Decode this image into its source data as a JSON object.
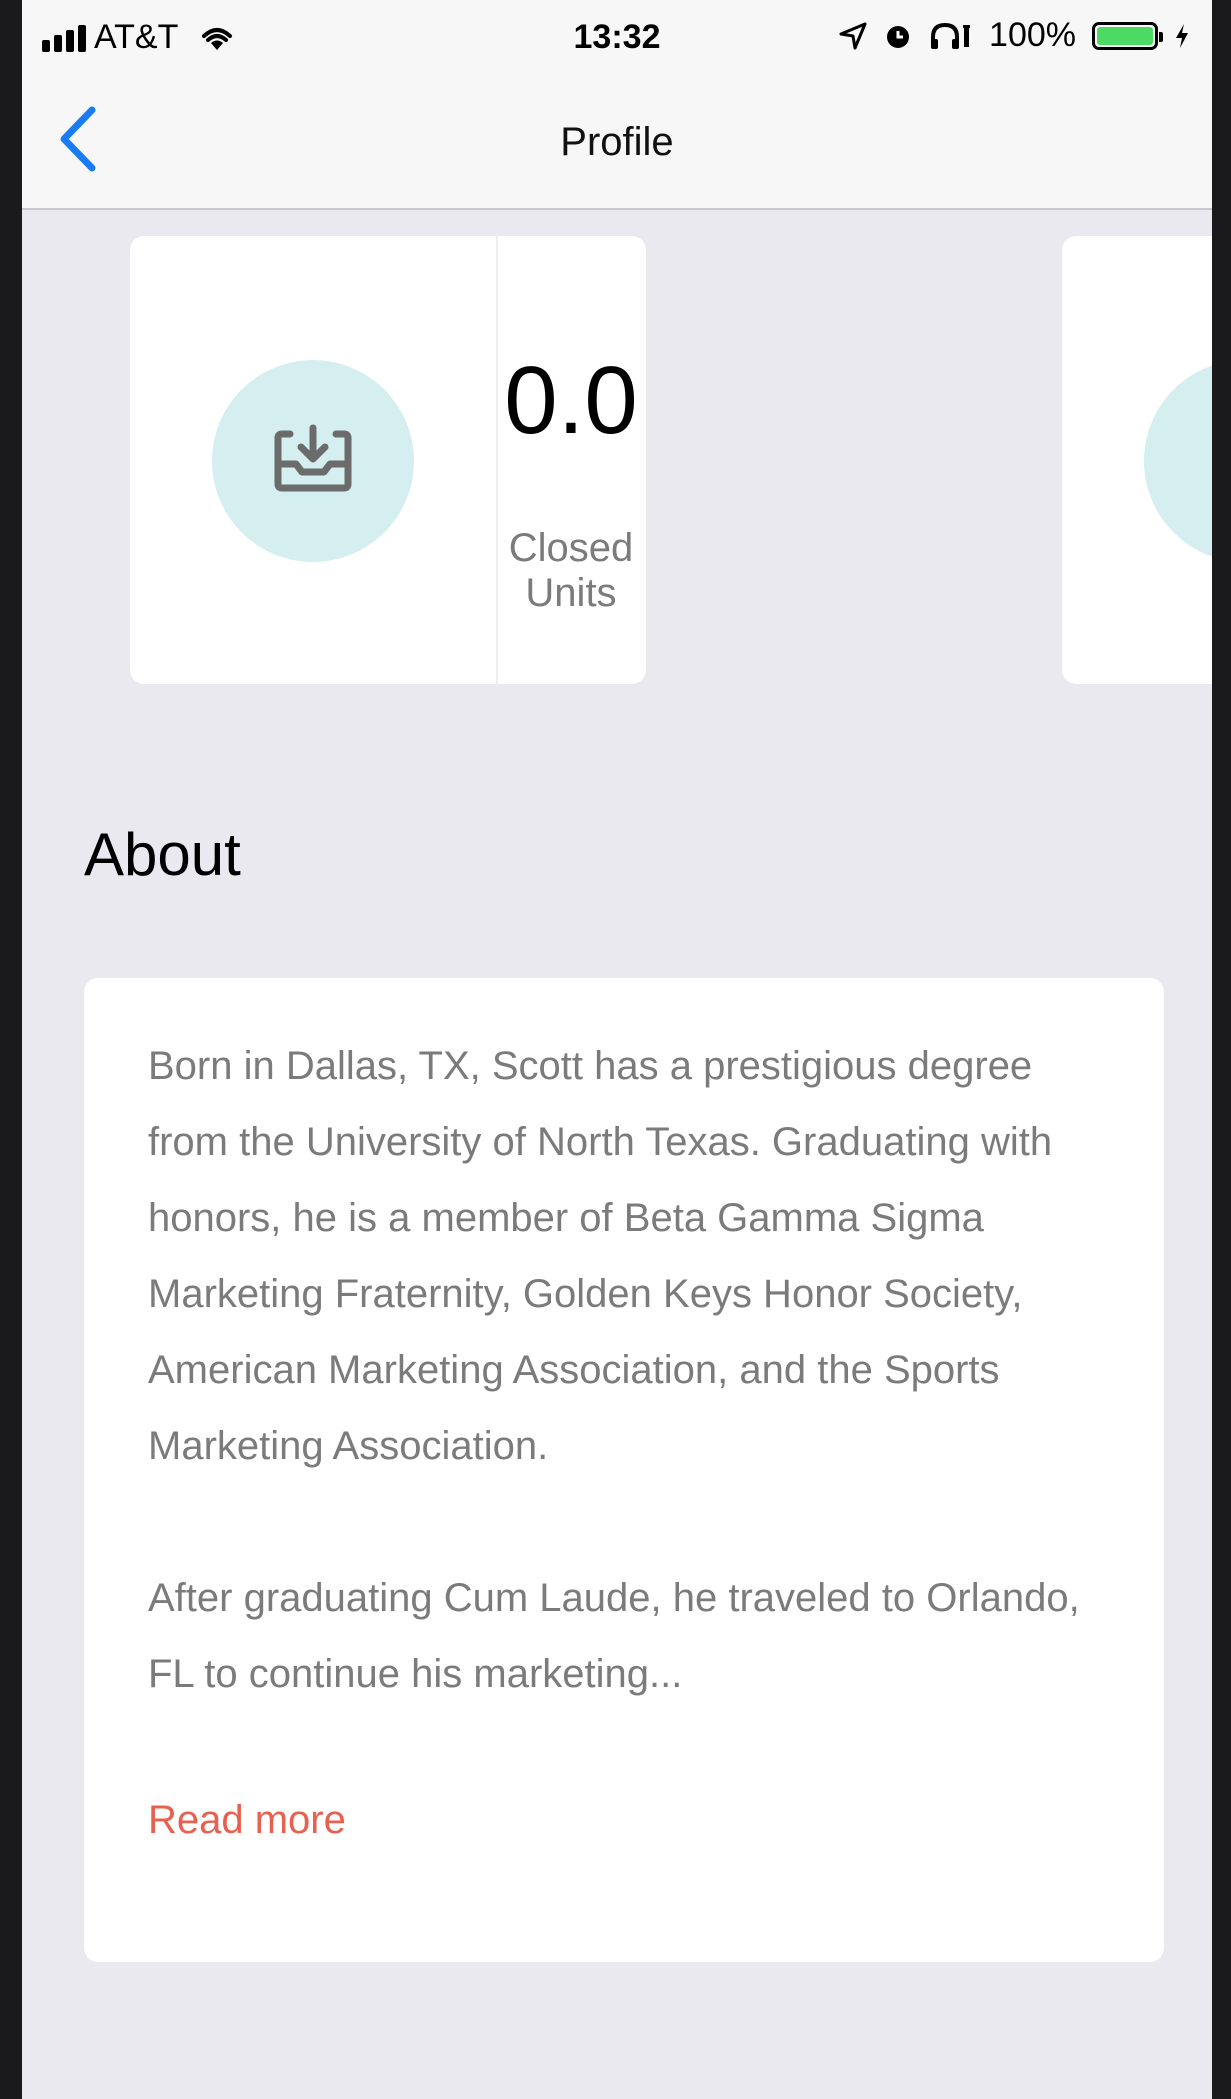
{
  "status_bar": {
    "carrier": "AT&T",
    "time": "13:32",
    "battery": "100%",
    "battery_level": 1.0,
    "battery_color": "#4cd964"
  },
  "nav": {
    "title": "Profile",
    "back_icon": "chevron-left-icon",
    "accent": "#1a7cf5"
  },
  "stats": [
    {
      "icon": "inbox-download-icon",
      "value": "0.0",
      "label": "Closed Units"
    }
  ],
  "about": {
    "heading": "About",
    "paragraphs": [
      "Born in Dallas, TX, Scott has a prestigious degree from the University of North Texas. Graduating with honors, he is a member of Beta Gamma Sigma Marketing Fraternity, Golden Keys Honor Society, American Marketing Association, and the Sports Marketing Association.",
      "After graduating Cum Laude, he traveled to Orlando, FL to continue his marketing..."
    ],
    "read_more": "Read more",
    "read_more_color": "#e8604f"
  }
}
